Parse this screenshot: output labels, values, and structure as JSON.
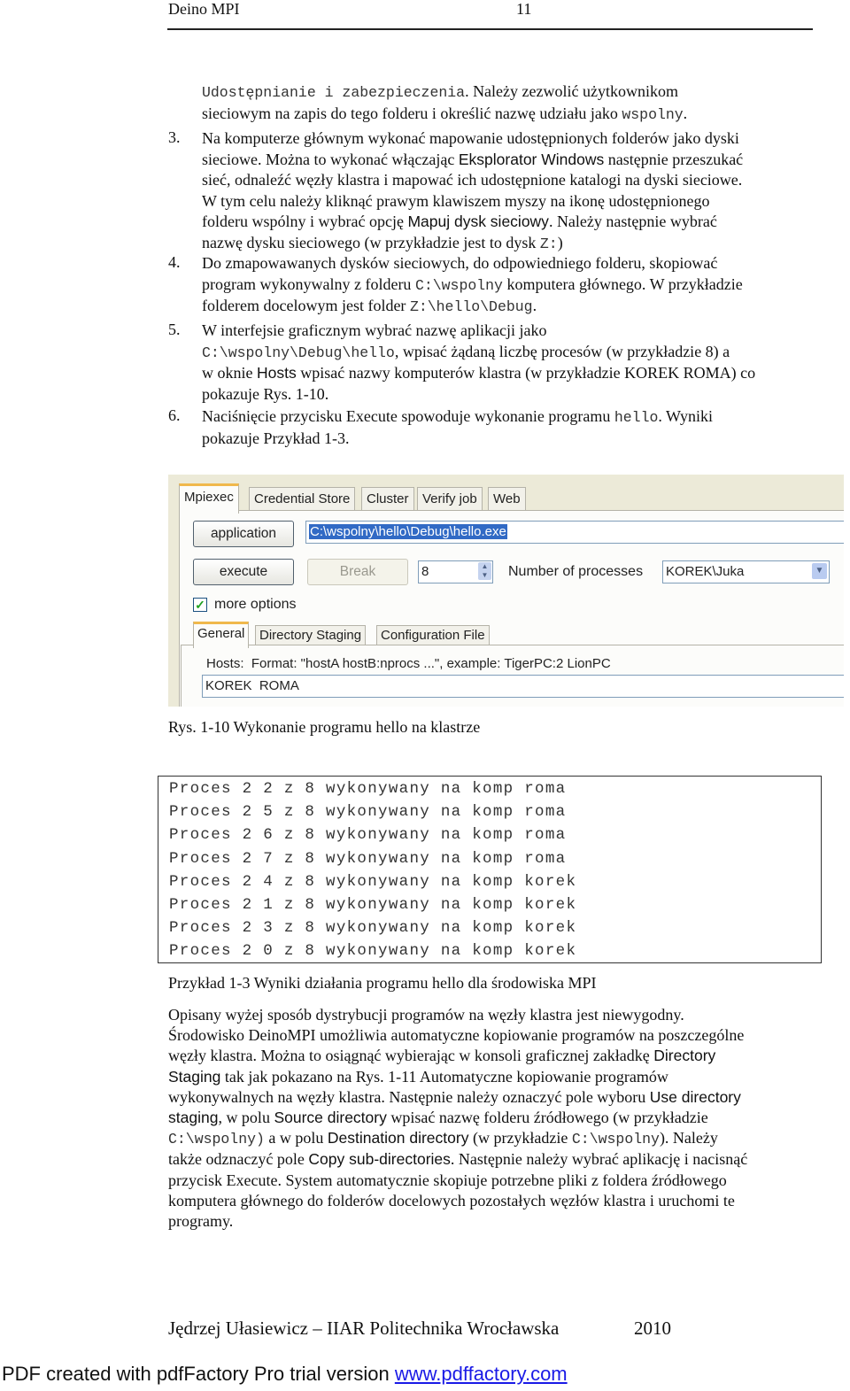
{
  "header": {
    "title": "Deino MPI",
    "page_number": "11"
  },
  "step2_continuation": {
    "l1_mono": "Udostępnianie i zabezpieczenia",
    "l1_text": ". Należy zezwolić użytkownikom",
    "l2_text": "sieciowym na zapis do tego folderu i określić nazwę udziału jako ",
    "l2_mono": "wspolny",
    "l2_end": "."
  },
  "steps": [
    {
      "number": "3.",
      "lines": [
        [
          "Na komputerze głównym wykonać mapowanie udostępnionych folderów jako dyski"
        ],
        [
          "sieciowe. Można to wykonać włączając ",
          {
            "sans": "Eksplorator Windows"
          },
          " następnie przeszukać"
        ],
        [
          "sieć, odnaleźć węzły klastra i  mapować ich udostępnione katalogi na dyski sieciowe."
        ],
        [
          "W tym celu należy kliknąć prawym klawiszem myszy na ikonę udostępnionego"
        ],
        [
          "folderu wspólny i wybrać opcję ",
          {
            "sans": "Mapuj dysk sieciowy"
          },
          ". Należy następnie wybrać"
        ],
        [
          "nazwę dysku sieciowego (w przykładzie jest to dysk ",
          {
            "mono": "Z:"
          },
          ")"
        ]
      ]
    },
    {
      "number": "4.",
      "lines": [
        [
          "Do zmapowawanych dysków sieciowych, do odpowiedniego folderu, skopiować"
        ],
        [
          "program wykonywalny z folderu ",
          {
            "mono": "C:\\wspolny"
          },
          " komputera głównego. W przykładzie"
        ],
        [
          "folderem docelowym jest folder ",
          {
            "mono": "Z:\\hello\\Debug"
          },
          "."
        ]
      ]
    },
    {
      "number": "5.",
      "lines": [
        [
          "W interfejsie graficznym wybrać nazwę aplikacji jako"
        ],
        [
          {
            "mono": "C:\\wspolny\\Debug\\hello"
          },
          ", wpisać żądaną liczbę procesów (w przykładzie 8) a"
        ],
        [
          "w oknie ",
          {
            "sans": "Hosts"
          },
          " wpisać nazwy komputerów klastra (w przykładzie KOREK ROMA) co"
        ],
        [
          "pokazuje Rys. 1-10."
        ]
      ]
    },
    {
      "number": "6.",
      "lines": [
        [
          "Naciśnięcie przycisku Execute spowoduje wykonanie programu ",
          {
            "mono": "hello"
          },
          ". Wyniki"
        ],
        [
          "pokazuje Przykład 1-3."
        ]
      ]
    }
  ],
  "gui": {
    "tabs": [
      "Mpiexec",
      "Credential Store",
      "Cluster",
      "Verify job",
      "Web"
    ],
    "active_tab": "Mpiexec",
    "application_button": "application",
    "application_path": "C:\\wspolny\\hello\\Debug\\hello.exe",
    "execute_button": "execute",
    "break_button": "Break",
    "num_processes_value": "8",
    "num_processes_label": "Number of processes",
    "user_select_value": "KOREK\\Juka",
    "more_options_label": "more options",
    "more_options_checked": true,
    "subtabs": [
      "General",
      "Directory Staging",
      "Configuration File"
    ],
    "active_subtab": "General",
    "hosts_hint": "Hosts:  Format: \"hostA hostB:nprocs ...\", example: TigerPC:2 LionPC",
    "hosts_value": "KOREK  ROMA"
  },
  "figure_caption": "Rys. 1-10 Wykonanie programu hello na klastrze",
  "output_lines": [
    "Proces 2 2 z 8 wykonywany na komp roma",
    "Proces 2 5 z 8 wykonywany na komp roma",
    "Proces 2 6 z 8 wykonywany na komp roma",
    "Proces 2 7 z 8 wykonywany na komp roma",
    "Proces 2 4 z 8 wykonywany na komp korek",
    "Proces 2 1 z 8 wykonywany na komp korek",
    "Proces 2 3 z 8 wykonywany na komp korek",
    "Proces 2 0 z 8 wykonywany na komp korek"
  ],
  "example_caption": "Przykład 1-3 Wyniki działania programu hello dla środowiska MPI",
  "body_paragraph": [
    [
      "Opisany wyżej sposób dystrybucji programów na węzły klastra jest niewygodny."
    ],
    [
      "Środowisko DeinoMPI umożliwia automatyczne kopiowanie programów na poszczególne"
    ],
    [
      "węzły klastra. Można to osiągnąć wybierając w konsoli graficznej zakładkę ",
      {
        "sans": "Directory"
      }
    ],
    [
      {
        "sans": "Staging"
      },
      " tak jak pokazano na Rys. 1-11 Automatyczne kopiowanie programów"
    ],
    [
      "wykonywalnych na węzły klastra. Następnie należy oznaczyć pole wyboru ",
      {
        "sans": "Use directory"
      }
    ],
    [
      {
        "sans": "staging"
      },
      ", w polu ",
      {
        "sans": "Source directory"
      },
      " wpisać nazwę folderu źródłowego (w przykładzie"
    ],
    [
      {
        "mono": "C:\\wspolny)"
      },
      " a w polu ",
      {
        "sans": "Destination directory"
      },
      " (w przykładzie ",
      {
        "mono": "C:\\wspolny"
      },
      "). Należy"
    ],
    [
      "także odznaczyć pole ",
      {
        "sans": "Copy sub-directories"
      },
      ". Następnie należy wybrać aplikację i nacisnąć"
    ],
    [
      "przycisk Execute. System automatycznie skopiuje potrzebne pliki z foldera źródłowego"
    ],
    [
      "komputera głównego do folderów docelowych pozostałych węzłów klastra i uruchomi te"
    ],
    [
      "programy."
    ]
  ],
  "footer": {
    "author": "Jędrzej Ułasiewicz – IIAR Politechnika Wrocławska",
    "year": "2010"
  },
  "watermark": {
    "text": "PDF created with pdfFactory Pro trial version ",
    "link": "www.pdffactory.com"
  }
}
